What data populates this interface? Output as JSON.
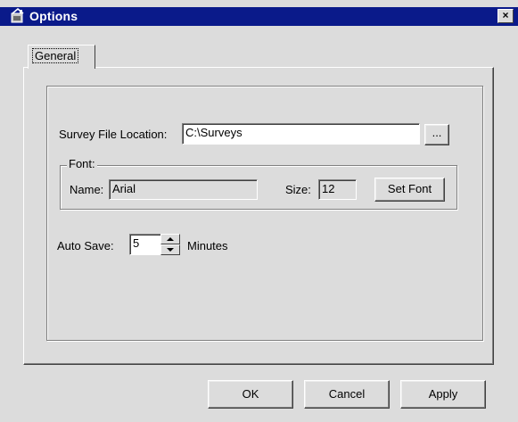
{
  "window": {
    "title": "Options",
    "close_label": "×"
  },
  "tabs": [
    {
      "label": "General",
      "selected": true
    }
  ],
  "survey": {
    "label": "Survey File Location:",
    "value": "C:\\Surveys",
    "browse_label": "..."
  },
  "font": {
    "group_label": "Font:",
    "name_label": "Name:",
    "name_value": "Arial",
    "size_label": "Size:",
    "size_value": "12",
    "set_font_label": "Set Font"
  },
  "autosave": {
    "label": "Auto Save:",
    "value": "5",
    "unit_label": "Minutes"
  },
  "buttons": {
    "ok": "OK",
    "cancel": "Cancel",
    "apply": "Apply"
  },
  "icons": {
    "title_icon": "options-icon",
    "close_icon": "close-icon"
  }
}
